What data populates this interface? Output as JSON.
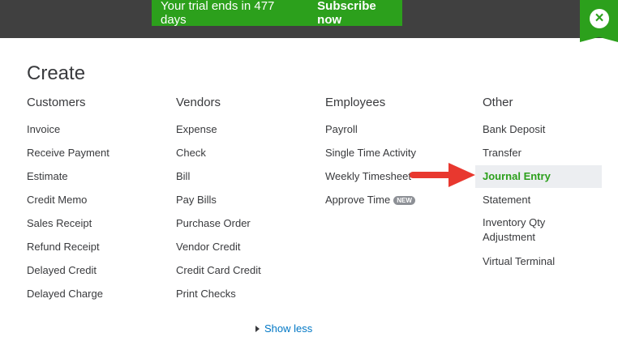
{
  "banner": {
    "trial_text": "Your trial ends in 477 days",
    "subscribe_label": "Subscribe now"
  },
  "close_icon": "×",
  "title": "Create",
  "columns": [
    {
      "heading": "Customers",
      "items": [
        "Invoice",
        "Receive Payment",
        "Estimate",
        "Credit Memo",
        "Sales Receipt",
        "Refund Receipt",
        "Delayed Credit",
        "Delayed Charge"
      ]
    },
    {
      "heading": "Vendors",
      "items": [
        "Expense",
        "Check",
        "Bill",
        "Pay Bills",
        "Purchase Order",
        "Vendor Credit",
        "Credit Card Credit",
        "Print Checks"
      ]
    },
    {
      "heading": "Employees",
      "items": [
        "Payroll",
        "Single Time Activity",
        "Weekly Timesheet",
        "Approve Time"
      ],
      "badge": "NEW"
    },
    {
      "heading": "Other",
      "items": [
        "Bank Deposit",
        "Transfer",
        "Journal Entry",
        "Statement",
        "Inventory Qty Adjustment",
        "Virtual Terminal"
      ]
    }
  ],
  "show_less_label": "Show less",
  "colors": {
    "topbar": "#404040",
    "accent_green": "#2ca01c",
    "link_blue": "#0077c5",
    "arrow_red": "#e8382f",
    "highlight_bg": "#eceef1"
  }
}
